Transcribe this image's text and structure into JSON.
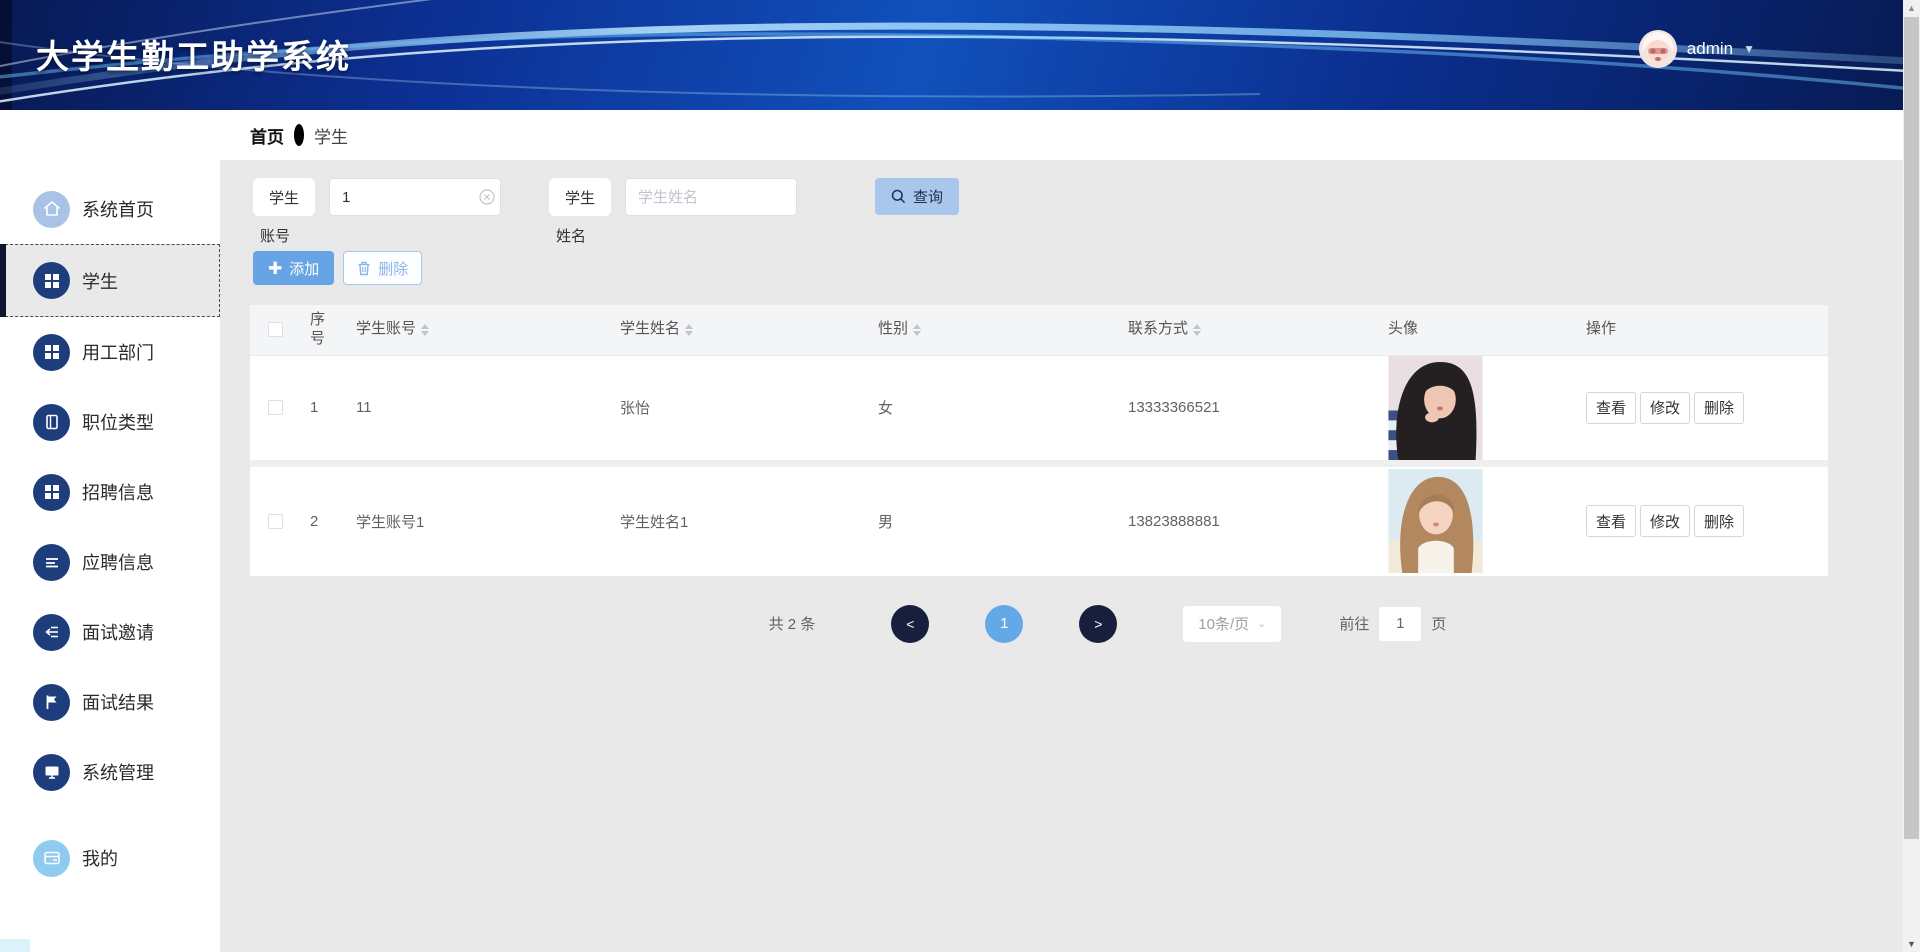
{
  "header": {
    "title": "大学生勤工助学系统",
    "username": "admin"
  },
  "breadcrumb": {
    "home": "首页",
    "current": "学生"
  },
  "sidebar": {
    "items": [
      {
        "label": "系统首页"
      },
      {
        "label": "学生"
      },
      {
        "label": "用工部门"
      },
      {
        "label": "职位类型"
      },
      {
        "label": "招聘信息"
      },
      {
        "label": "应聘信息"
      },
      {
        "label": "面试邀请"
      },
      {
        "label": "面试结果"
      },
      {
        "label": "系统管理"
      },
      {
        "label": "我的"
      }
    ]
  },
  "filters": {
    "account_label_line1": "学生",
    "account_label_line2": "账号",
    "account_value": "1",
    "name_label_line1": "学生",
    "name_label_line2": "姓名",
    "name_placeholder": "学生姓名",
    "search_label": "查询"
  },
  "toolbar": {
    "add_label": "添加",
    "delete_label": "删除"
  },
  "table": {
    "columns": [
      "序号",
      "学生账号",
      "学生姓名",
      "性别",
      "联系方式",
      "头像",
      "操作"
    ],
    "rows": [
      {
        "index": "1",
        "account": "11",
        "name": "张怡",
        "gender": "女",
        "phone": "13333366521"
      },
      {
        "index": "2",
        "account": "学生账号1",
        "name": "学生姓名1",
        "gender": "男",
        "phone": "13823888881"
      }
    ],
    "actions": {
      "view": "查看",
      "edit": "修改",
      "delete": "删除"
    }
  },
  "pagination": {
    "total": "共 2 条",
    "page": "1",
    "page_size": "10条/页",
    "goto_label": "前往",
    "goto_value": "1",
    "goto_unit": "页"
  },
  "colors": {
    "accent_blue": "#66a4e6",
    "query_blue": "#a9c6ed",
    "navy_circle": "#16203e",
    "active_page": "#64a8e8",
    "sidebar_icon_navy": "#1d3d7c",
    "header_blue": "#0c2f92"
  }
}
